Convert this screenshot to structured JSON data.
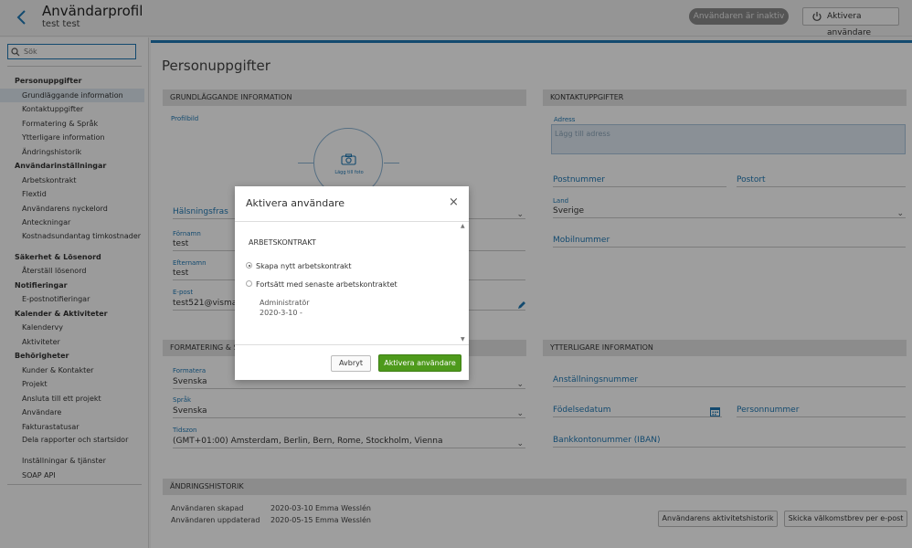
{
  "header": {
    "title": "Användarprofil",
    "subtitle": "test test",
    "inactive_badge": "Användaren är inaktiv",
    "activate_button": "Aktivera användare"
  },
  "sidebar": {
    "search_placeholder": "Sök",
    "items": [
      {
        "label": "Personuppgifter",
        "type": "group"
      },
      {
        "label": "Grundläggande information",
        "type": "child",
        "active": true
      },
      {
        "label": "Kontaktuppgifter",
        "type": "child"
      },
      {
        "label": "Formatering & Språk",
        "type": "child"
      },
      {
        "label": "Ytterligare information",
        "type": "child"
      },
      {
        "label": "Ändringshistorik",
        "type": "child"
      },
      {
        "label": "Användarinställningar",
        "type": "group"
      },
      {
        "label": "Arbetskontrakt",
        "type": "child"
      },
      {
        "label": "Flextid",
        "type": "child"
      },
      {
        "label": "Användarens nyckelord",
        "type": "child"
      },
      {
        "label": "Anteckningar",
        "type": "child"
      },
      {
        "label": "Kostnadsundantag timkostnader",
        "type": "child"
      },
      {
        "label": "Säkerhet & Lösenord",
        "type": "group"
      },
      {
        "label": "Återställ lösenord",
        "type": "child"
      },
      {
        "label": "Notifieringar",
        "type": "group"
      },
      {
        "label": "E-postnotifieringar",
        "type": "child"
      },
      {
        "label": "Kalender & Aktiviteter",
        "type": "group"
      },
      {
        "label": "Kalendervy",
        "type": "child"
      },
      {
        "label": "Aktiviteter",
        "type": "child"
      },
      {
        "label": "Behörigheter",
        "type": "group"
      },
      {
        "label": "Kunder & Kontakter",
        "type": "child"
      },
      {
        "label": "Projekt",
        "type": "child"
      },
      {
        "label": "Ansluta till ett projekt",
        "type": "child"
      },
      {
        "label": "Användare",
        "type": "child"
      },
      {
        "label": "Fakturastatusar",
        "type": "child"
      },
      {
        "label": "Dela rapporter och startsidor",
        "type": "child"
      },
      {
        "label": "Inställningar & tjänster",
        "type": "child"
      },
      {
        "label": "SOAP API",
        "type": "child"
      }
    ]
  },
  "main": {
    "page_title": "Personuppgifter",
    "basic": {
      "heading": "Grundläggande information",
      "profile_picture_label": "Profilbild",
      "add_photo": "Lägg till foto",
      "greeting_label": "Hälsningsfras",
      "firstname_label": "Förnamn",
      "firstname_value": "test",
      "lastname_label": "Efternamn",
      "lastname_value": "test",
      "email_label": "E-post",
      "email_value": "test521@visma.co"
    },
    "contact": {
      "heading": "Kontaktuppgifter",
      "address_label": "Adress",
      "address_placeholder": "Lägg till adress",
      "postal_code": "Postnummer",
      "city": "Postort",
      "country_label": "Land",
      "country_value": "Sverige",
      "mobile": "Mobilnummer"
    },
    "formatting": {
      "heading": "Formatering & S",
      "format_label": "Formatera",
      "format_value": "Svenska",
      "language_label": "Språk",
      "language_value": "Svenska",
      "timezone_label": "Tidszon",
      "timezone_value": "(GMT+01:00) Amsterdam, Berlin, Bern, Rome, Stockholm, Vienna"
    },
    "additional": {
      "heading": "Ytterligare information",
      "employment_number": "Anställningsnummer",
      "birth_date": "Födelsedatum",
      "personal_number": "Personnummer",
      "bank_account": "Bankkontonummer (IBAN)"
    },
    "history": {
      "heading": "Ändringshistorik",
      "created_label": "Användaren skapad",
      "created_date": "2020-03-10",
      "created_by": "Emma Wesslén",
      "updated_label": "Användaren uppdaterad",
      "updated_date": "2020-05-15",
      "updated_by": "Emma Wesslén",
      "activity_button": "Användarens aktivitetshistorik",
      "welcome_button": "Skicka välkomstbrev per e-post"
    }
  },
  "modal": {
    "title": "Aktivera användare",
    "close": "×",
    "section": "Arbetskontrakt",
    "option_new": "Skapa nytt arbetskontrakt",
    "option_continue": "Fortsätt med senaste arbetskontraktet",
    "role": "Administratör",
    "date_range": "2020-3-10 -",
    "cancel": "Avbryt",
    "confirm": "Aktivera användare"
  },
  "colors": {
    "accent": "#1f78b4",
    "primary_button": "#4e9a1c",
    "inactive_badge": "#8a8a8a"
  }
}
